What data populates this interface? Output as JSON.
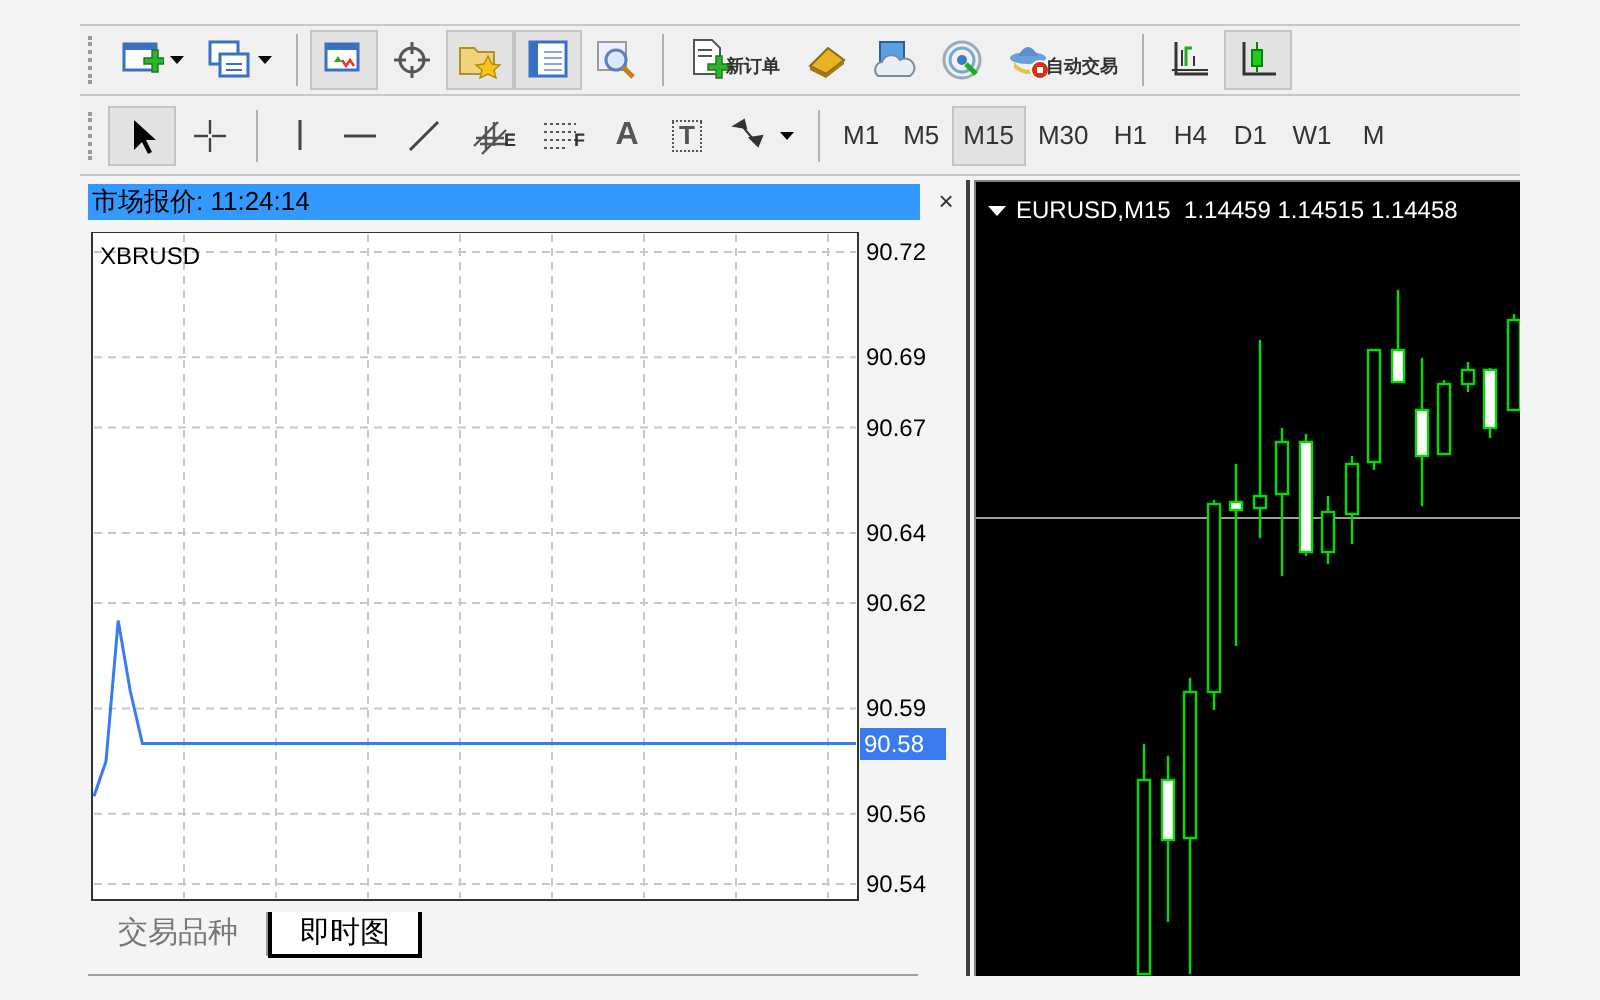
{
  "toolbar_1": {
    "groups": [
      [
        {
          "selected": false
        },
        {
          "selected": false
        }
      ],
      [
        {
          "selected": true
        },
        {
          "selected": false
        },
        {
          "selected": true
        },
        {
          "selected": true
        },
        {
          "selected": false
        }
      ],
      [
        {
          "label": "新订单",
          "selected": false
        },
        {
          "selected": false
        },
        {
          "selected": false
        },
        {
          "selected": false
        },
        {
          "label": "自动交易",
          "selected": false
        }
      ],
      [
        {
          "selected": false
        },
        {
          "selected": true
        }
      ]
    ]
  },
  "toolbar_2": {
    "groups": [
      [
        {
          "selected": true
        },
        {
          "selected": false
        }
      ],
      [
        {
          "selected": false
        },
        {
          "selected": false
        },
        {
          "selected": false
        },
        {
          "label": "E",
          "selected": false
        },
        {
          "label": "F",
          "selected": false
        },
        {
          "label": "A",
          "selected": false
        },
        {
          "label": "T",
          "selected": false
        },
        {
          "selected": false
        }
      ],
      [
        {
          "label": "M1",
          "selected": false
        },
        {
          "label": "M5",
          "selected": false
        },
        {
          "label": "M15",
          "selected": true
        },
        {
          "label": "M30",
          "selected": false
        },
        {
          "label": "H1",
          "selected": false
        },
        {
          "label": "H4",
          "selected": false
        },
        {
          "label": "D1",
          "selected": false
        },
        {
          "label": "W1",
          "selected": false
        },
        {
          "label": "M",
          "selected": false
        }
      ]
    ]
  },
  "market_watch": {
    "title": "市场报价: 11:24:14",
    "close": "×",
    "current_price": "90.58",
    "chart_data": {
      "type": "line",
      "categories": [
        null,
        null,
        null,
        null,
        null,
        null,
        null,
        null,
        null,
        null,
        null,
        null,
        null,
        null,
        null,
        null,
        null,
        null,
        null,
        null,
        null,
        null,
        null,
        null,
        null,
        null,
        null,
        null,
        null,
        null,
        null,
        null,
        null,
        null,
        null,
        null,
        null,
        null,
        null,
        null,
        null,
        null,
        null,
        null,
        null,
        null,
        null,
        null,
        null,
        null,
        null,
        null,
        null,
        null,
        null,
        null,
        null,
        null,
        null,
        null,
        null,
        null,
        null,
        null
      ],
      "series": [
        {
          "name": "XBRUSD",
          "color": "#3b7bf0",
          "values": [
            90.565,
            90.575,
            90.615,
            90.595,
            90.58,
            90.58,
            90.58,
            90.58,
            90.58,
            90.58,
            90.58,
            90.58,
            90.58,
            90.58,
            90.58,
            90.58,
            90.58,
            90.58,
            90.58,
            90.58,
            90.58,
            90.58,
            90.58,
            90.58,
            90.58,
            90.58,
            90.58,
            90.58,
            90.58,
            90.58,
            90.58,
            90.58,
            90.58,
            90.58,
            90.58,
            90.58,
            90.58,
            90.58,
            90.58,
            90.58,
            90.58,
            90.58,
            90.58,
            90.58,
            90.58,
            90.58,
            90.58,
            90.58,
            90.58,
            90.58,
            90.58,
            90.58,
            90.58,
            90.58,
            90.58,
            90.58,
            90.58,
            90.58,
            90.58,
            90.58,
            90.58,
            90.58,
            90.58,
            90.58
          ]
        }
      ],
      "ylim": [
        90.54,
        90.72
      ],
      "grid": true,
      "yticks": [
        90.72,
        90.69,
        90.67,
        90.64,
        90.62,
        90.59,
        90.56,
        90.54
      ]
    },
    "tabs": [
      {
        "label": "交易品种",
        "selected": false
      },
      {
        "label": "即时图",
        "selected": true
      }
    ]
  },
  "chart_window": {
    "title": "EURUSD,M15  1.14459 1.14515 1.14458"
  }
}
